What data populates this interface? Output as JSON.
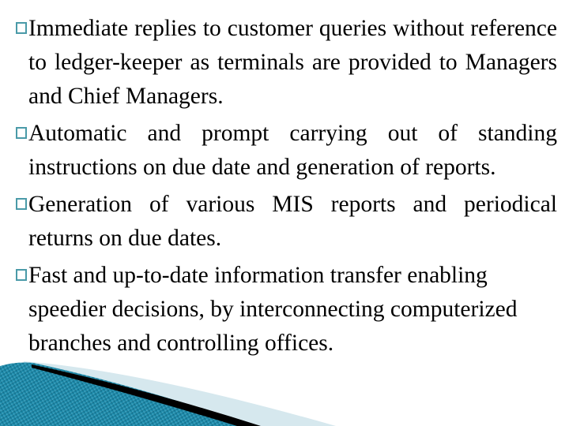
{
  "slide": {
    "bullets": [
      {
        "text": "Immediate replies to customer queries without reference to ledger-keeper as terminals are provided to Managers and Chief Managers."
      },
      {
        "text": "Automatic and prompt carrying out of standing instructions on due date and generation of reports."
      },
      {
        "text": "Generation of various MIS reports and periodical returns on due dates."
      },
      {
        "text": "Fast and up-to-date information transfer enabling speedier decisions, by interconnecting computerized branches and controlling offices."
      }
    ],
    "colors": {
      "bullet": "#4a9aa8",
      "swoosh_dark": "#0e6b85",
      "swoosh_light": "#d6e8ee",
      "swoosh_line": "#000000"
    }
  }
}
